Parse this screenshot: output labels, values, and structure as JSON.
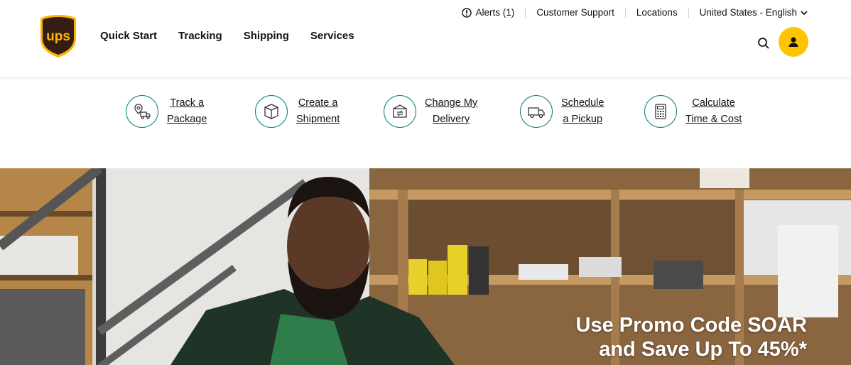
{
  "brand": {
    "name": "UPS",
    "logo_text": "ups",
    "color_brown": "#351c15",
    "color_gold": "#ffb500"
  },
  "nav": {
    "items": [
      {
        "label": "Quick Start"
      },
      {
        "label": "Tracking"
      },
      {
        "label": "Shipping"
      },
      {
        "label": "Services"
      }
    ]
  },
  "utility": {
    "alerts": "Alerts (1)",
    "support": "Customer Support",
    "locations": "Locations",
    "language": "United States - English"
  },
  "icons": {
    "search": "search-icon",
    "profile": "user-icon"
  },
  "quick_links": [
    {
      "line1": "Track a",
      "line2": "Package",
      "icon": "track-package-icon"
    },
    {
      "line1": "Create a",
      "line2": "Shipment",
      "icon": "box-icon"
    },
    {
      "line1": "Change My",
      "line2": "Delivery",
      "icon": "change-delivery-icon"
    },
    {
      "line1": "Schedule",
      "line2": "a Pickup",
      "icon": "truck-icon"
    },
    {
      "line1": "Calculate",
      "line2": "Time & Cost",
      "icon": "calculator-icon"
    }
  ],
  "hero": {
    "line1": "Use Promo Code SOAR",
    "line2": "and Save Up To 45%*"
  },
  "colors": {
    "accent_teal": "#0a8080",
    "accent_yellow": "#ffc400"
  }
}
